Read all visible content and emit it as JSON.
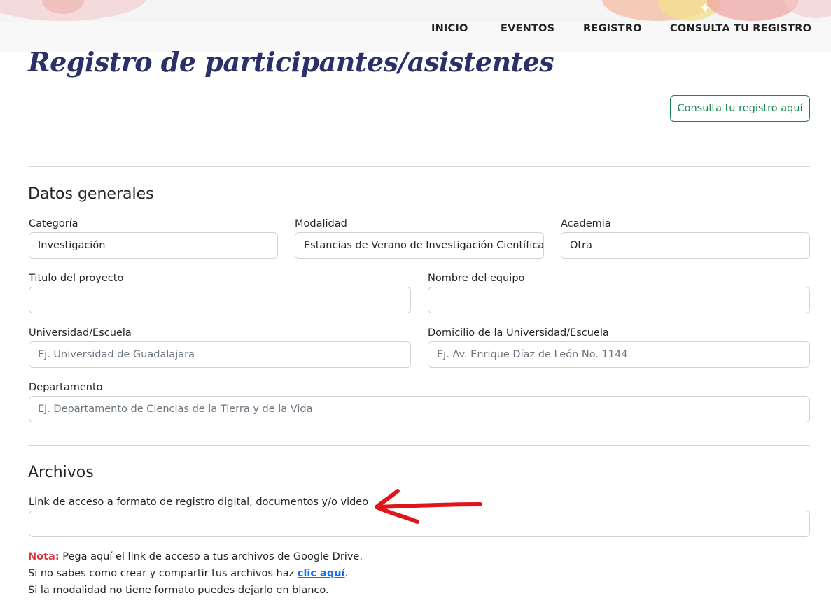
{
  "nav": {
    "items": [
      {
        "label": "INICIO"
      },
      {
        "label": "EVENTOS"
      },
      {
        "label": "REGISTRO"
      },
      {
        "label": "CONSULTA TU REGISTRO"
      }
    ]
  },
  "page": {
    "title": "Registro de participantes/asistentes",
    "consulta_button": "Consulta tu registro aquí"
  },
  "datos_generales": {
    "title": "Datos generales",
    "categoria": {
      "label": "Categoría",
      "value": "Investigación"
    },
    "modalidad": {
      "label": "Modalidad",
      "value": "Estancias de Verano de Investigación Científica"
    },
    "academia": {
      "label": "Academia",
      "value": "Otra"
    },
    "titulo_proyecto": {
      "label": "Titulo del proyecto",
      "value": ""
    },
    "nombre_equipo": {
      "label": "Nombre del equipo",
      "value": ""
    },
    "universidad": {
      "label": "Universidad/Escuela",
      "placeholder": "Ej. Universidad de Guadalajara"
    },
    "domicilio": {
      "label": "Domicilio de la Universidad/Escuela",
      "placeholder": "Ej. Av. Enrique Díaz de León No. 1144"
    },
    "departamento": {
      "label": "Departamento",
      "placeholder": "Ej. Departamento de Ciencias de la Tierra y de la Vida"
    }
  },
  "archivos": {
    "title": "Archivos",
    "link": {
      "label": "Link de acceso a formato de registro digital, documentos y/o video",
      "value": ""
    },
    "note_prefix": "Nota:",
    "note_line1": " Pega aquí el link de acceso a tus archivos de Google Drive.",
    "note_line2_pre": "Si no sabes como crear y compartir tus archivos haz ",
    "note_line2_link": "clic aquí",
    "note_line2_post": ".",
    "note_line3": "Si la modalidad no tiene formato puedes dejarlo en blanco."
  },
  "colors": {
    "title": "#2b3069",
    "success": "#198754",
    "danger": "#dc3545",
    "link": "#0d6efd",
    "annotation_arrow": "#e0141b"
  }
}
